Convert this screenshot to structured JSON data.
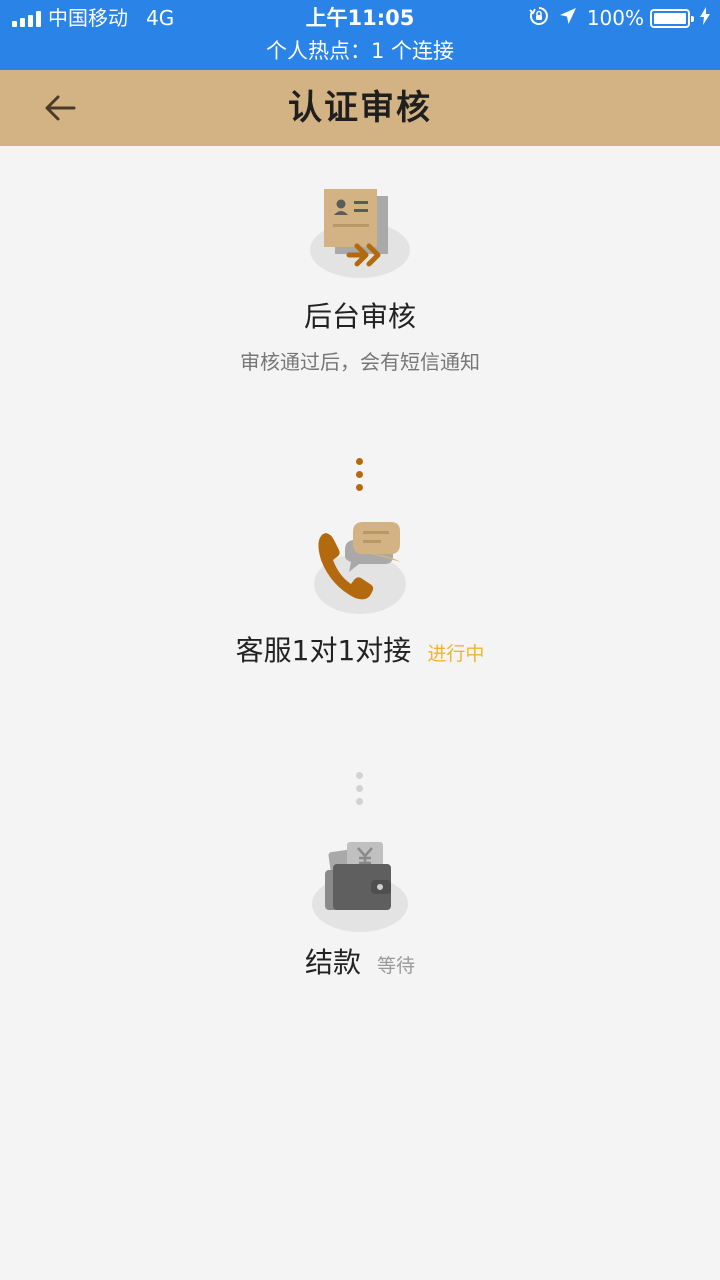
{
  "status_bar": {
    "carrier": "中国移动",
    "network": "4G",
    "time": "上午11:05",
    "battery": "100%",
    "hotspot": "个人热点：1 个连接"
  },
  "nav": {
    "title": "认证审核",
    "back_icon": "arrow-left-icon"
  },
  "steps": [
    {
      "icon": "document-transfer-icon",
      "title": "后台审核",
      "subtitle": "审核通过后，会有短信通知",
      "state": "done"
    },
    {
      "icon": "phone-chat-icon",
      "title": "客服1对1对接",
      "badge": "进行中",
      "state": "active"
    },
    {
      "icon": "wallet-yuan-icon",
      "title": "结款",
      "badge": "等待",
      "state": "waiting"
    }
  ],
  "colors": {
    "status_bg": "#2a83e6",
    "nav_bg": "#d3b383",
    "accent": "#b36a0f",
    "badge_active": "#f3b331",
    "badge_wait": "#9a9a9a",
    "page_bg": "#f4f4f4"
  }
}
